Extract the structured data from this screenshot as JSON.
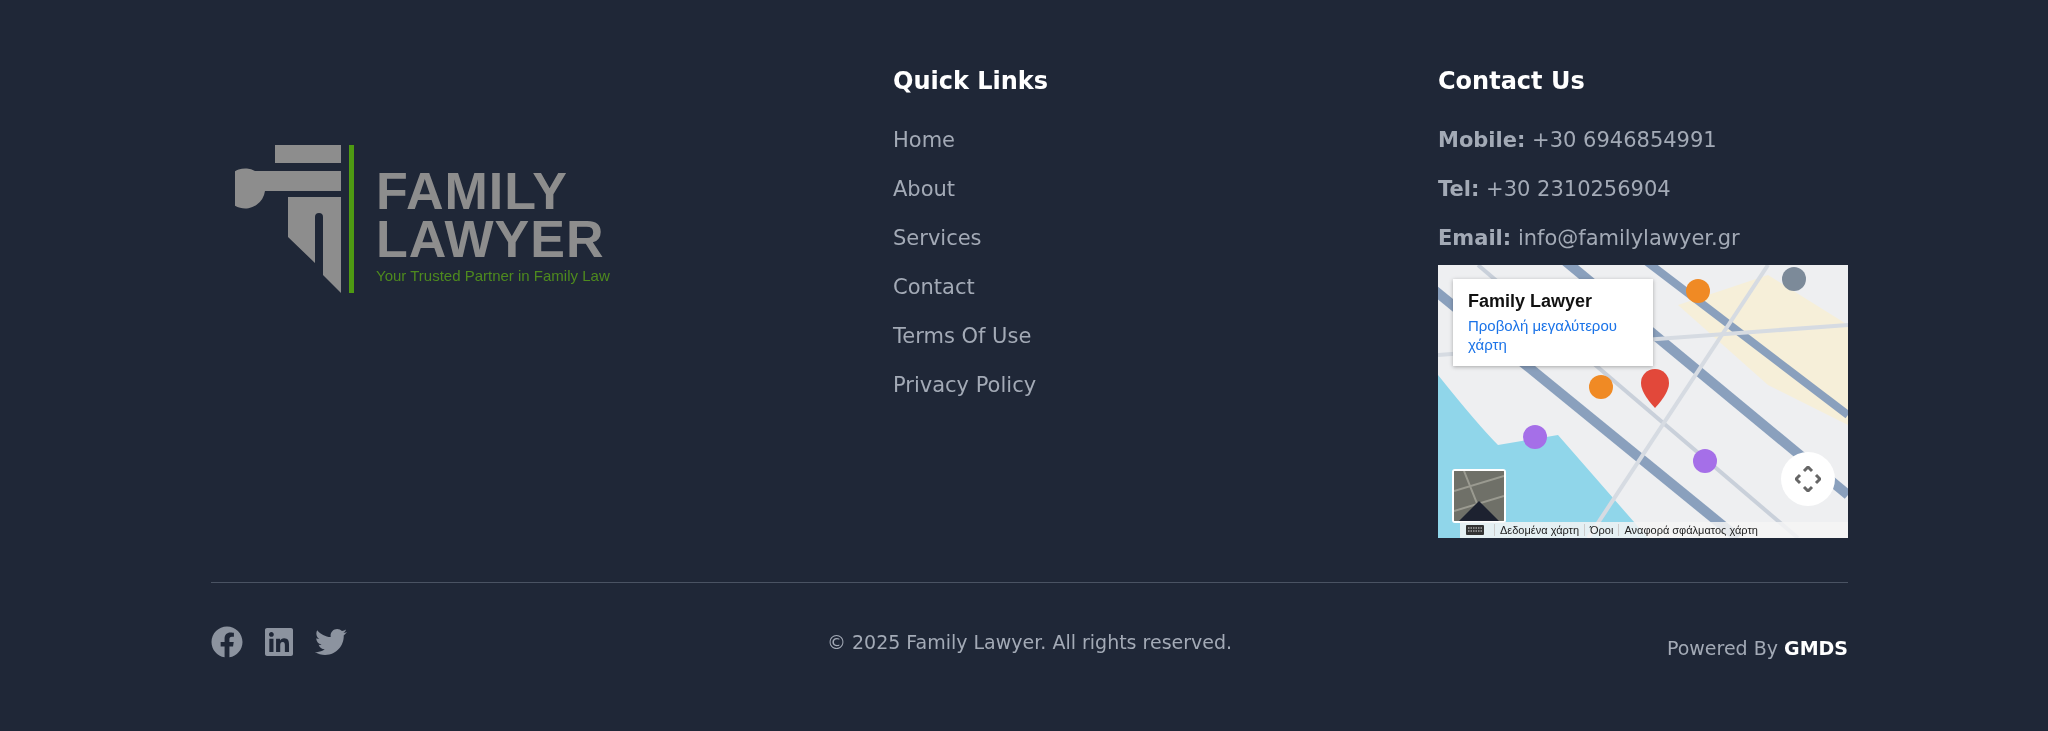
{
  "logo": {
    "title_line_1": "FAMILY",
    "title_line_2": "LAWYER",
    "tagline": "Your Trusted Partner in Family Law"
  },
  "quick_links": {
    "heading": "Quick Links",
    "items": [
      "Home",
      "About",
      "Services",
      "Contact",
      "Terms Of Use",
      "Privacy Policy"
    ]
  },
  "contact": {
    "heading": "Contact Us",
    "items": [
      "**Mobile:** +30 6946854991",
      "**Tel:** +30 2310256904",
      "**Email:** info@familylawyer.gr"
    ],
    "map": {
      "kind": "picture",
      "place_card": {
        "title": "Family Lawyer",
        "link": "Προβολή μεγαλύτερου χάρτη"
      },
      "attribution": [
        "Δεδομένα χάρτη",
        "Όροι",
        "Αναφορά σφάλματος χάρτη"
      ]
    }
  },
  "footer": {
    "copyright": "© 2025 Family Lawyer. All rights reserved.",
    "powered_by": "Powered By **GMDS**"
  }
}
